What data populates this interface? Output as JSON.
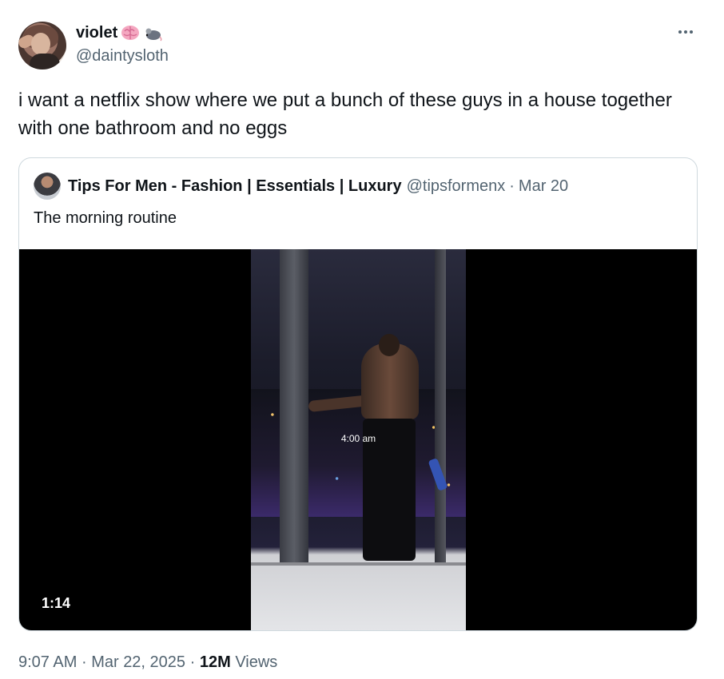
{
  "author": {
    "display_name": "violet",
    "badges": [
      "brain-emoji",
      "mouse-emoji"
    ],
    "handle": "@daintysloth"
  },
  "tweet": {
    "text": "i want a netflix show where we put a bunch of these guys in a house together with one bathroom and no eggs"
  },
  "quoted_tweet": {
    "display_name": "Tips For Men - Fashion | Essentials | Luxury",
    "handle": "@tipsformenx",
    "separator": "·",
    "date": "Mar 20",
    "text": "The morning routine",
    "video": {
      "overlay_caption": "4:00 am",
      "duration": "1:14"
    }
  },
  "meta": {
    "time": "9:07 AM",
    "separator": "·",
    "date": "Mar 22, 2025",
    "views_count": "12M",
    "views_label": "Views"
  },
  "colors": {
    "text_primary": "#0f1419",
    "text_secondary": "#536471",
    "border": "#cfd9de",
    "background": "#ffffff"
  },
  "icons": {
    "more": "more-horizontal-icon"
  }
}
